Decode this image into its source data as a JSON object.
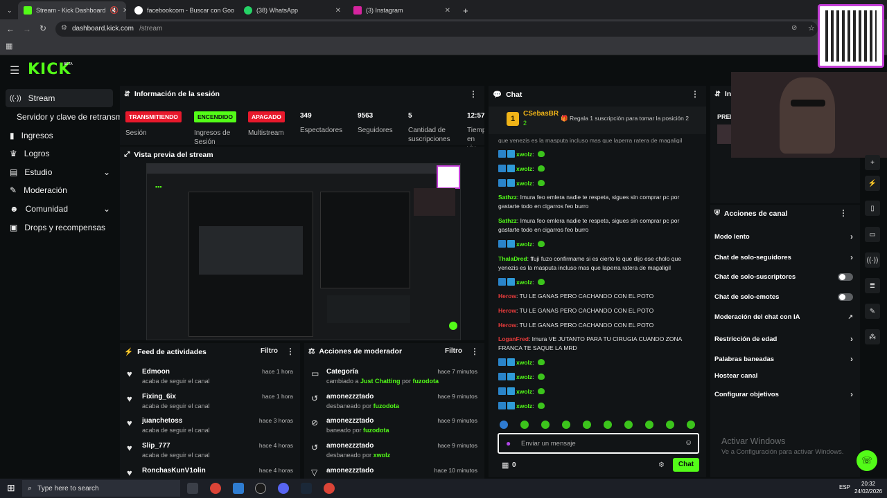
{
  "browser": {
    "tabs": [
      {
        "title": "Stream - Kick Dashboard",
        "active": true
      },
      {
        "title": "facebookcom - Buscar con Goo"
      },
      {
        "title": "(38) WhatsApp"
      },
      {
        "title": "(3) Instagram"
      }
    ],
    "url_host": "dashboard.kick.com",
    "url_path": "/stream"
  },
  "kick": {
    "logo": "KICK",
    "logo_sup": "BETA"
  },
  "sidebar": {
    "items": [
      {
        "label": "Stream",
        "icon": "broadcast-icon"
      },
      {
        "label": "Servidor y clave de retransm",
        "icon": ""
      },
      {
        "label": "Ingresos",
        "icon": "chart-icon"
      },
      {
        "label": "Logros",
        "icon": "trophy-icon"
      },
      {
        "label": "Estudio",
        "icon": "layout-icon"
      },
      {
        "label": "Moderación",
        "icon": "wrench-icon"
      },
      {
        "label": "Comunidad",
        "icon": "people-icon"
      },
      {
        "label": "Drops y recompensas",
        "icon": "gift-icon"
      }
    ]
  },
  "session": {
    "title": "Información de la sesión",
    "badges": [
      {
        "label": "TRANSMITIENDO",
        "caption": "Sesión",
        "color": "#e8192c"
      },
      {
        "label": "ENCENDIDO",
        "caption": "Ingresos de Sesión",
        "color": "#53fc18"
      },
      {
        "label": "APAGADO",
        "caption": "Multistream",
        "color": "#e8192c"
      }
    ],
    "stats": [
      {
        "value": "349",
        "label": "Espectadores"
      },
      {
        "value": "9563",
        "label": "Seguidores"
      },
      {
        "value": "5",
        "label": "Cantidad de suscripciones"
      },
      {
        "value": "12:57:",
        "label": "Tiemp en viv"
      }
    ]
  },
  "preview": {
    "title": "Vista previa del stream"
  },
  "activity": {
    "title": "Feed de actividades",
    "filter": "Filtro",
    "items": [
      {
        "name": "Edmoon",
        "sub": "acaba de seguir el canal",
        "time": "hace 1 hora"
      },
      {
        "name": "Fixing_6ix",
        "sub": "acaba de seguir el canal",
        "time": "hace 1 hora"
      },
      {
        "name": "juanchetoss",
        "sub": "acaba de seguir el canal",
        "time": "hace 3 horas"
      },
      {
        "name": "Slip_777",
        "sub": "acaba de seguir el canal",
        "time": "hace 4 horas"
      },
      {
        "name": "RonchasKunV1olin",
        "sub": "",
        "time": "hace 4 horas"
      }
    ]
  },
  "modactions": {
    "title": "Acciones de moderador",
    "filter": "Filtro",
    "items": [
      {
        "name": "Categoría",
        "pre": "cambiado a ",
        "mid": "Just Chatting",
        "conj": " por ",
        "by": "fuzodota",
        "time": "hace 7 minutos"
      },
      {
        "name": "amonezzztado",
        "pre": "desbaneado por ",
        "mid": "",
        "conj": "",
        "by": "fuzodota",
        "time": "hace 9 minutos"
      },
      {
        "name": "amonezzztado",
        "pre": "baneado por ",
        "mid": "",
        "conj": "",
        "by": "fuzodota",
        "time": "hace 9 minutos"
      },
      {
        "name": "amonezzztado",
        "pre": "desbaneado por ",
        "mid": "",
        "conj": "",
        "by": "xwolz",
        "time": "hace 9 minutos"
      },
      {
        "name": "amonezzztado",
        "pre": "",
        "mid": "",
        "conj": "",
        "by": "",
        "time": "hace 10 minutos"
      }
    ]
  },
  "chat": {
    "title": "Chat",
    "pinned_user": "CSebasBR",
    "pinned_rank": "1",
    "pinned_count": "2",
    "pinned_msg": "Regala 1 suscripción para tomar la posición 2",
    "cut_line": "que yenezis es la masputa incluso mas que laperra ratera de magaligil",
    "messages": [
      {
        "user": "xwolz",
        "text": "",
        "color": "#53fc18",
        "badges": true
      },
      {
        "user": "xwolz",
        "text": "",
        "color": "#53fc18",
        "badges": true
      },
      {
        "user": "xwolz",
        "text": "",
        "color": "#53fc18",
        "badges": true
      },
      {
        "user": "Sathzz",
        "text": "Imura feo emlera nadie te respeta, sigues sin comprar pc por gastarte todo en cigarros feo burro",
        "color": "#53fc18"
      },
      {
        "user": "Sathzz",
        "text": "Imura feo emlera nadie te respeta, sigues sin comprar pc por gastarte todo en cigarros feo burro",
        "color": "#53fc18"
      },
      {
        "user": "xwolz",
        "text": "",
        "color": "#53fc18",
        "badges": true
      },
      {
        "user": "ThalaDred",
        "text": "ffuji fuzo confirmame si es cierto lo que dijo ese cholo que yenezis es la masputa incluso mas que laperra ratera de magaligil",
        "color": "#53fc18"
      },
      {
        "user": "xwolz",
        "text": "",
        "color": "#53fc18",
        "badges": true
      },
      {
        "user": "Herow",
        "text": "TU LE GANAS PERO CACHANDO CON EL POTO",
        "color": "#e83b3b"
      },
      {
        "user": "Herow",
        "text": "TU LE GANAS PERO CACHANDO CON EL POTO",
        "color": "#e83b3b"
      },
      {
        "user": "Herow",
        "text": "TU LE GANAS PERO CACHANDO CON EL POTO",
        "color": "#e83b3b"
      },
      {
        "user": "LoganFred",
        "text": "Imura VE JUTANTO PARA TU CIRUGIA CUANDO ZONA FRANCA TE SAQUE LA MRD",
        "color": "#e83b3b"
      },
      {
        "user": "xwolz",
        "text": "",
        "color": "#53fc18",
        "badges": true
      },
      {
        "user": "xwolz",
        "text": "",
        "color": "#53fc18",
        "badges": true
      },
      {
        "user": "xwolz",
        "text": "",
        "color": "#53fc18",
        "badges": true
      },
      {
        "user": "xwolz",
        "text": "",
        "color": "#53fc18",
        "badges": true
      }
    ],
    "input_placeholder": "Enviar un mensaje",
    "points": "0",
    "send_label": "Chat"
  },
  "channel_actions": {
    "title": "Acciones de canal",
    "info_title": "Inf",
    "info_label": "PREI",
    "items": [
      {
        "label": "Modo lento",
        "control": "chevron"
      },
      {
        "label": "Chat de solo-seguidores",
        "control": "chevron"
      },
      {
        "label": "Chat de solo-suscriptores",
        "control": "toggle"
      },
      {
        "label": "Chat de solo-emotes",
        "control": "toggle"
      },
      {
        "label": "Moderación del chat con IA",
        "control": "external"
      },
      {
        "label": "Restricción de edad",
        "control": "chevron"
      },
      {
        "label": "Palabras baneadas",
        "control": "chevron"
      },
      {
        "label": "Hostear canal",
        "control": "none"
      },
      {
        "label": "Configurar objetivos",
        "control": "chevron"
      }
    ]
  },
  "watermark": {
    "line1": "Activar Windows",
    "line2": "Ve a Configuración para activar Windows."
  },
  "taskbar": {
    "search": "Type here to search",
    "lang": "ESP",
    "time": "20:32",
    "date": "24/02/2026"
  },
  "colors": {
    "kick_green": "#53fc18",
    "live_red": "#e8192c"
  }
}
